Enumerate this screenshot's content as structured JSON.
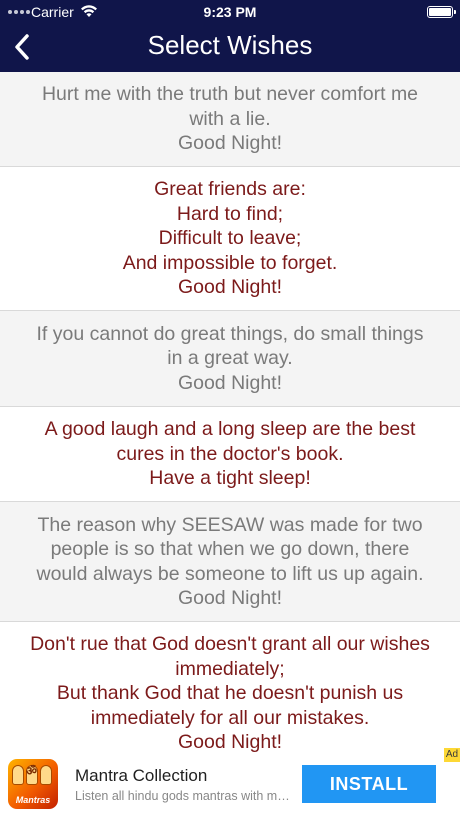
{
  "status_bar": {
    "carrier": "Carrier",
    "time": "9:23 PM"
  },
  "header": {
    "title": "Select Wishes",
    "background_color": "#10154a"
  },
  "wishes": [
    {
      "text": "Hurt me with the truth but never comfort me\nwith a lie.\nGood Night!",
      "color": "#7a7a7a"
    },
    {
      "text": "Great friends are:\nHard to find;\nDifficult to leave;\nAnd impossible to forget.\nGood Night!",
      "color": "#7c1a1a"
    },
    {
      "text": "If you cannot do great things, do small things\nin a great way.\nGood Night!",
      "color": "#7a7a7a"
    },
    {
      "text": "A good laugh and a long sleep are the best\ncures in the doctor's book.\nHave a tight sleep!",
      "color": "#7c1a1a"
    },
    {
      "text": "The reason why SEESAW was made for two\npeople is so that when we go down, there\nwould always be someone to lift us up again.\nGood Night!",
      "color": "#7a7a7a"
    },
    {
      "text": "Don't rue that God doesn't grant all our wishes\nimmediately;\nBut thank God that he doesn't punish us\nimmediately for all our mistakes.\nGood Night!",
      "color": "#7c1a1a"
    }
  ],
  "ad": {
    "badge": "Ad",
    "icon_brand": "Mantras",
    "title": "Mantra Collection",
    "description": "Listen all hindu gods mantras with meanings",
    "install_label": "INSTALL",
    "install_color": "#2196f3"
  }
}
